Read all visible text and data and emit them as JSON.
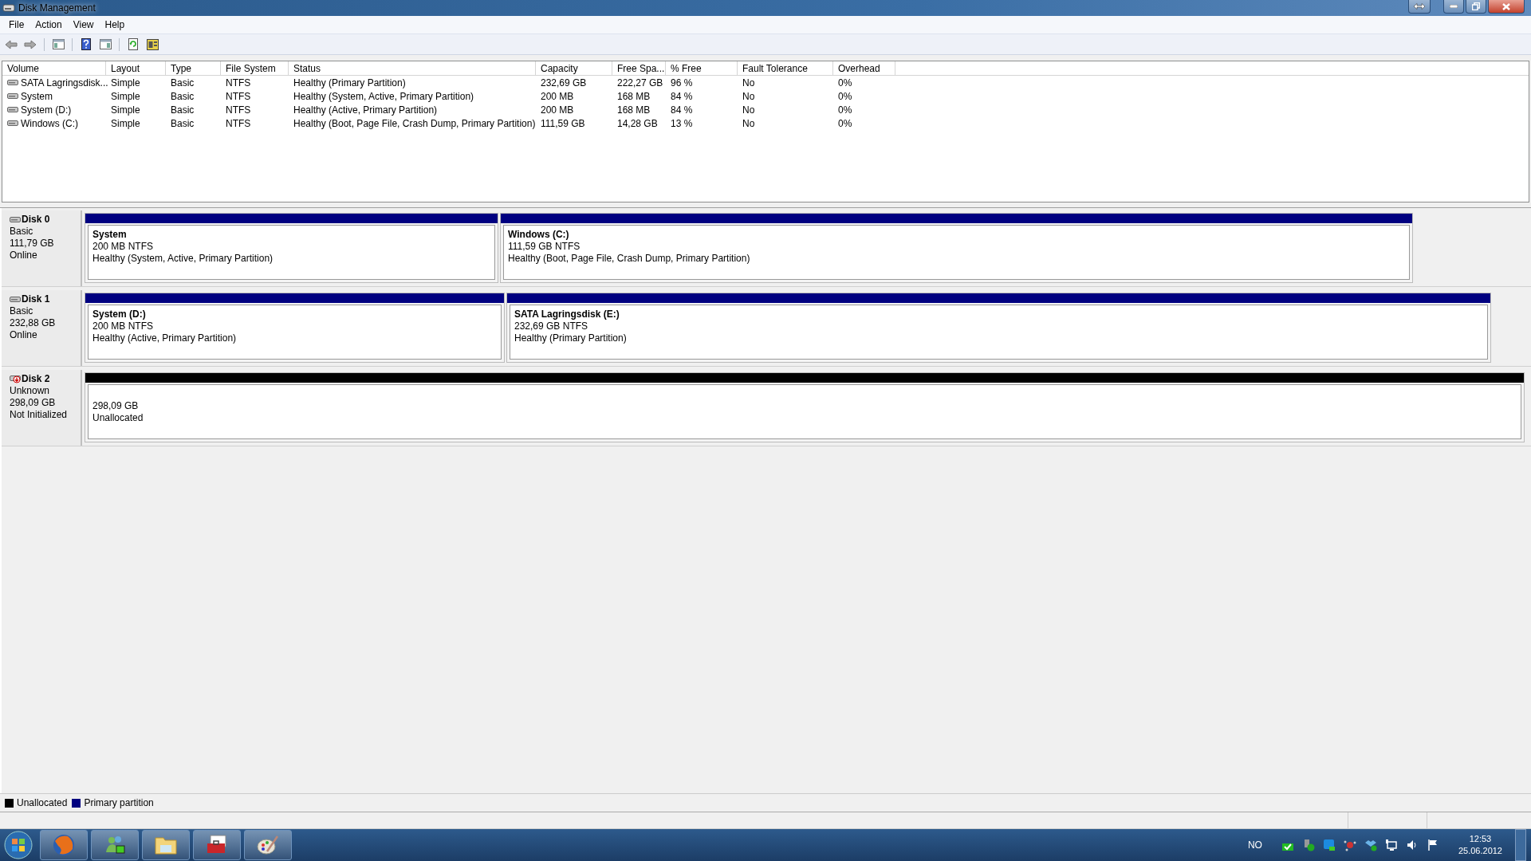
{
  "window": {
    "title": "Disk Management"
  },
  "menu": [
    "File",
    "Action",
    "View",
    "Help"
  ],
  "volumes": {
    "columns": [
      "Volume",
      "Layout",
      "Type",
      "File System",
      "Status",
      "Capacity",
      "Free Spa...",
      "% Free",
      "Fault Tolerance",
      "Overhead"
    ],
    "rows": [
      {
        "cells": [
          "SATA Lagringsdisk...",
          "Simple",
          "Basic",
          "NTFS",
          "Healthy (Primary Partition)",
          "232,69 GB",
          "222,27 GB",
          "96 %",
          "No",
          "0%"
        ]
      },
      {
        "cells": [
          "System",
          "Simple",
          "Basic",
          "NTFS",
          "Healthy (System, Active, Primary Partition)",
          "200 MB",
          "168 MB",
          "84 %",
          "No",
          "0%"
        ]
      },
      {
        "cells": [
          "System (D:)",
          "Simple",
          "Basic",
          "NTFS",
          "Healthy (Active, Primary Partition)",
          "200 MB",
          "168 MB",
          "84 %",
          "No",
          "0%"
        ]
      },
      {
        "cells": [
          "Windows (C:)",
          "Simple",
          "Basic",
          "NTFS",
          "Healthy (Boot, Page File, Crash Dump, Primary Partition)",
          "111,59 GB",
          "14,28 GB",
          "13 %",
          "No",
          "0%"
        ]
      }
    ]
  },
  "disks": [
    {
      "name": "Disk 0",
      "initialized": true,
      "type": "Basic",
      "size": "111,79 GB",
      "status": "Online",
      "partitions": [
        {
          "kind": "primary",
          "name": "System",
          "size": "200 MB NTFS",
          "status": "Healthy (System, Active, Primary Partition)"
        },
        {
          "kind": "primary",
          "name": "Windows  (C:)",
          "size": "111,59 GB NTFS",
          "status": "Healthy (Boot, Page File, Crash Dump, Primary Partition)"
        }
      ]
    },
    {
      "name": "Disk 1",
      "initialized": true,
      "type": "Basic",
      "size": "232,88 GB",
      "status": "Online",
      "partitions": [
        {
          "kind": "primary",
          "name": "System  (D:)",
          "size": "200 MB NTFS",
          "status": "Healthy (Active, Primary Partition)"
        },
        {
          "kind": "primary",
          "name": "SATA Lagringsdisk  (E:)",
          "size": "232,69 GB NTFS",
          "status": "Healthy (Primary Partition)"
        }
      ]
    },
    {
      "name": "Disk 2",
      "initialized": false,
      "type": "Unknown",
      "size": "298,09 GB",
      "status": "Not Initialized",
      "partitions": [
        {
          "kind": "unallocated",
          "size": "298,09 GB",
          "status": "Unallocated"
        }
      ]
    }
  ],
  "legend": [
    {
      "kind": "unallocated",
      "label": "Unallocated"
    },
    {
      "kind": "primary",
      "label": "Primary partition"
    }
  ],
  "taskbar": {
    "language": "NO",
    "time": "12:53",
    "date": "25.06.2012"
  }
}
